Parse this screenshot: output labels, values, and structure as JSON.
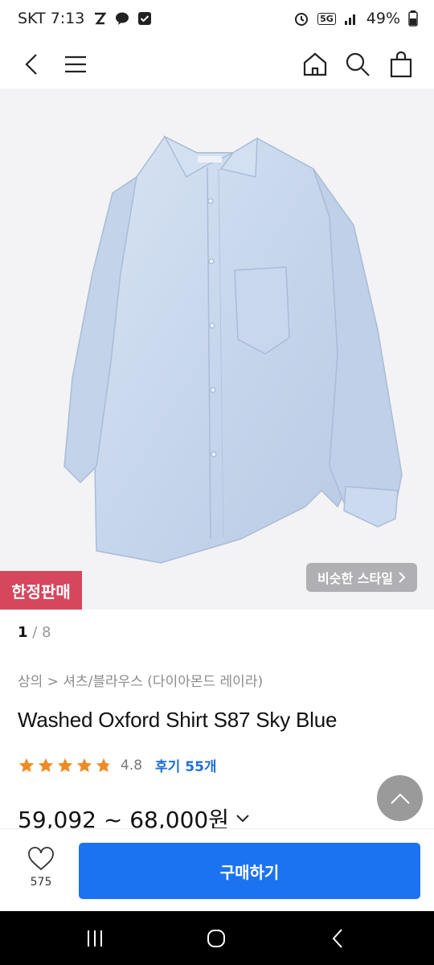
{
  "status_bar": {
    "carrier_time": "SKT 7:13",
    "network": "5G",
    "battery": "49%"
  },
  "header": {
    "icons": [
      "back-icon",
      "menu-icon",
      "home-icon",
      "search-icon",
      "cart-icon"
    ]
  },
  "hero": {
    "badge": "한정판매",
    "similar_style": "비슷한 스타일",
    "product_color": "#c9d8ec"
  },
  "pager": {
    "current": "1",
    "total": "/ 8"
  },
  "breadcrumb": "상의 > 셔츠/블라우스 (다이아몬드 레이라)",
  "product": {
    "title": "Washed Oxford Shirt S87 Sky Blue",
    "rating_value": "4.8",
    "rating_stars": 4.8,
    "reviews": "후기 55개",
    "price": "59,092 ~ 68,000원"
  },
  "bottom_bar": {
    "like_count": "575",
    "buy_label": "구매하기"
  },
  "colors": {
    "accent": "#1c73f2",
    "badge": "#d6465c",
    "star": "#f08a24",
    "review_link": "#1f6fd8"
  }
}
